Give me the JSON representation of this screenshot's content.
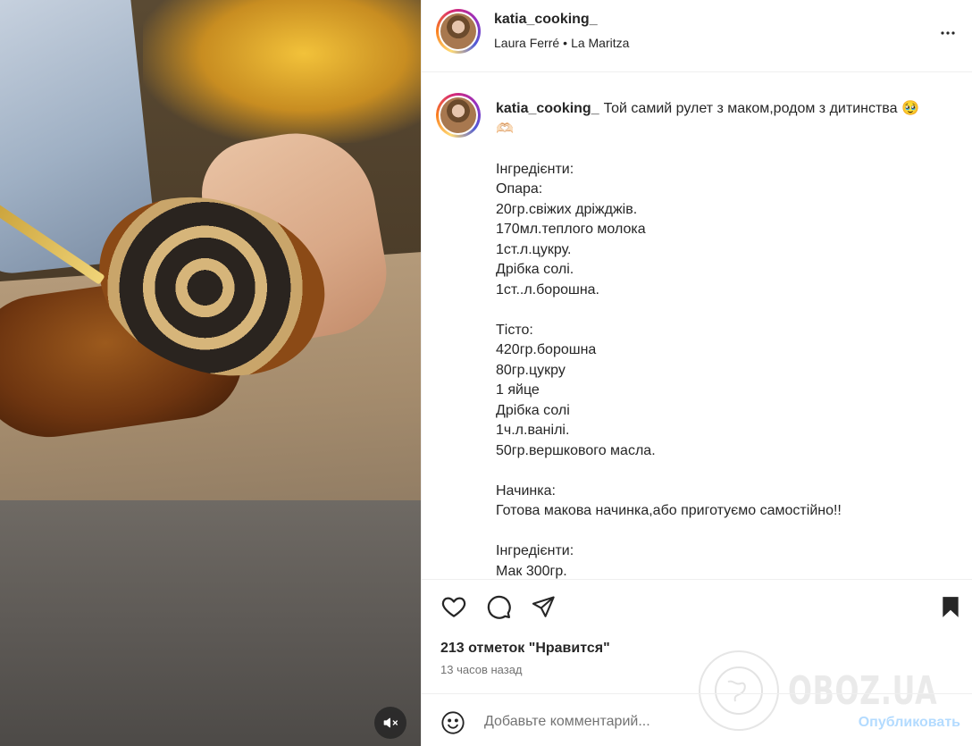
{
  "post": {
    "author": "katia_cooking_",
    "audio": "Laura Ferré",
    "location": "La Maritza",
    "dot": "•",
    "caption_intro": "Той самий рулет з маком,родом з дитинства 🥹",
    "caption_intro_emoji2": "🫶🏻",
    "caption_lines": [
      "",
      "Інгредієнти:",
      "Опара:",
      "20гр.свіжих дріжджів.",
      "170мл.теплого молока",
      "1ст.л.цукру.",
      "Дрібка солі.",
      "1ст..л.борошна.",
      "",
      "Тісто:",
      "420гр.борошна",
      "80гр.цукру",
      "1 яйце",
      "Дрібка солі",
      "1ч.л.ванілі.",
      "50гр.вершкового масла.",
      "",
      "Начинка:",
      "Готова макова начинка,або приготуємо самостійно!!",
      "",
      "Інгредієнти:",
      "Мак 300гр."
    ],
    "likes_text": "213 отметок \"Нравится\"",
    "time_text": "13 часов назад"
  },
  "comment": {
    "placeholder": "Добавьте комментарий...",
    "publish_label": "Опубликовать"
  },
  "watermark": {
    "text": "OBOZ.UA"
  },
  "colors": {
    "publish_disabled": "#b3dbff",
    "text_primary": "#262626",
    "text_secondary": "#737373"
  },
  "icons": {
    "header_more": "more-horizontal-icon",
    "like": "heart-icon",
    "comment": "comment-bubble-icon",
    "share": "send-paper-plane-icon",
    "save": "bookmark-filled-icon",
    "emoji": "smiley-icon",
    "mute": "speaker-muted-icon"
  }
}
